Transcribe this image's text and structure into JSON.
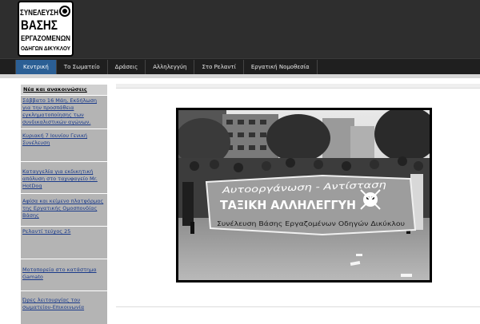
{
  "logo": {
    "lines": [
      "ΣΥΝΕΛΕΥΣΗ",
      "ΒΑΣΗΣ",
      "ΕΡΓΑΖΟΜΕΝΩΝ",
      "ΟΔΗΓΩΝ ΔΙΚΥΚΛΟΥ"
    ]
  },
  "nav": {
    "items": [
      "Κεντρική",
      "Το Σωματείο",
      "Δράσεις",
      "Αλληλεγγύη",
      "Στο Ρελαντί",
      "Εργατική Νομοθεσία"
    ],
    "active_index": 0
  },
  "sidebar": {
    "title": "Νέα και ανακοινώσεις",
    "items": [
      "Σάββατο 16 Μάη, Εκδήλωση για την προσπάθεια εγκληματοποίησης των συνδικαλιστικών αγώνων.",
      "Κυριακή 7 Ιουνίου Γενική Συνέλευση",
      "Καταγγελία για εκδικητική απόλυση στο ταχυφαγείο Mr. HotDog",
      "Αφίσα και κείμενο πλατφόρμας της Εργατικής Ομοσπονδίας Βάσης",
      "Ρελαντί τεύχος 25",
      "Μοτοπορεία στο κατάστημα Gamato",
      "Ώρες λειτουργίας του σωματείου-Επικοινωνία"
    ]
  },
  "photo": {
    "banner_line1": "Αυτοοργάνωση - Αντίσταση",
    "banner_line2": "ΤΑΞΙΚΗ ΑΛΛΗΛΕΓΓΥΗ",
    "banner_line3": "Συνέλευση Βάσης Εργαζομένων Οδηγών Δικύκλου"
  },
  "colors": {
    "header_bg": "#2e2e2e",
    "nav_active": "#2b5f95",
    "link": "#1a3a8a",
    "sidebar_item_bg": "#b4b4b4"
  }
}
